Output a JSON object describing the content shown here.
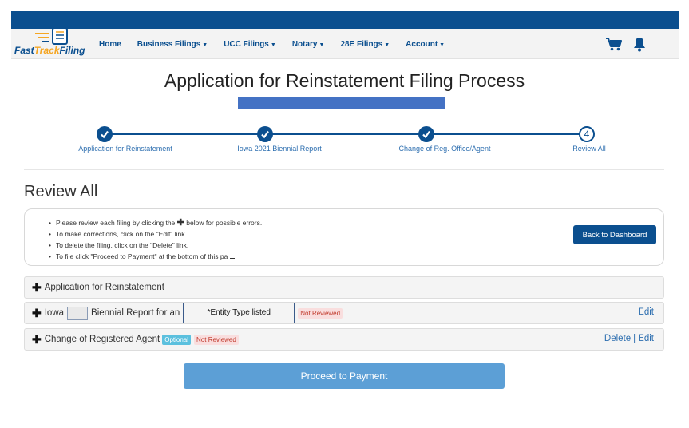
{
  "brand": {
    "logo_text_a": "Fast",
    "logo_text_b": "Track",
    "logo_text_c": "Filing"
  },
  "nav": {
    "items": [
      {
        "label": "Home",
        "has_caret": false
      },
      {
        "label": "Business Filings",
        "has_caret": true
      },
      {
        "label": "UCC Filings",
        "has_caret": true
      },
      {
        "label": "Notary",
        "has_caret": true
      },
      {
        "label": "28E Filings",
        "has_caret": true
      },
      {
        "label": "Account",
        "has_caret": true
      }
    ],
    "icons": [
      "cart-icon",
      "bell-icon"
    ]
  },
  "page": {
    "title": "Application for Reinstatement Filing Process"
  },
  "stepper": {
    "steps": [
      {
        "label": "Application for Reinstatement",
        "status": "complete"
      },
      {
        "label": "Iowa 2021 Biennial Report",
        "status": "complete"
      },
      {
        "label": "Change of Reg. Office/Agent",
        "status": "complete"
      },
      {
        "label": "Review All",
        "status": "current",
        "number": "4"
      }
    ]
  },
  "review": {
    "title": "Review All",
    "instructions": {
      "line1_before": "Please review each filing by clicking the",
      "line1_after": "below for possible errors.",
      "line2": "To make corrections, click on the \"Edit\" link.",
      "line3": "To delete the filing, click on the \"Delete\" link.",
      "line4": "To file click \"Proceed to Payment\" at the bottom of this pa"
    },
    "back_button": "Back to Dashboard"
  },
  "filings": [
    {
      "label": "Application for Reinstatement"
    },
    {
      "label_a": "Iowa",
      "label_b": "Biennial Report for an",
      "entity": "*Entity Type listed",
      "badge": "Not Reviewed",
      "edit": "Edit"
    },
    {
      "label": "Change of Registered Agent",
      "optional": "Optional",
      "badge": "Not Reviewed",
      "delete": "Delete",
      "separator": "|",
      "edit": "Edit"
    }
  ],
  "proceed_button": "Proceed to Payment",
  "colors": {
    "primary": "#0b4f8f",
    "link": "#2e6fb0",
    "proceed": "#5c9fd6",
    "redaction": "#4472c4"
  }
}
